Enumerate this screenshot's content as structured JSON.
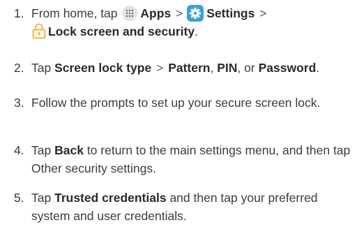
{
  "steps": [
    {
      "number": "1.",
      "parts": {
        "prefix": "From home, tap",
        "apps": "Apps",
        "sep1": ">",
        "settings": "Settings",
        "sep2": ">",
        "lock": "Lock screen and security",
        "suffix": "."
      },
      "icons": [
        "apps-grid-icon",
        "settings-gear-icon",
        "lock-icon"
      ]
    },
    {
      "number": "2.",
      "parts": {
        "prefix": "Tap",
        "screen_lock_type": "Screen lock type",
        "sep": ">",
        "pattern": "Pattern",
        "comma1": ",",
        "pin": "PIN",
        "or": ", or",
        "password": "Password",
        "suffix": "."
      }
    },
    {
      "number": "3.",
      "text": "Follow the prompts to set up your secure screen lock."
    },
    {
      "number": "4.",
      "parts": {
        "prefix": "Tap",
        "back": "Back",
        "rest": "to return to the main settings menu, and then tap Other security settings."
      }
    },
    {
      "number": "5.",
      "parts": {
        "prefix": "Tap",
        "trusted": "Trusted credentials",
        "rest": "and then tap your preferred system and user credentials."
      }
    }
  ],
  "colors": {
    "text": "#3c3c3c",
    "settings_icon_bg": "#3aa0db",
    "lock_icon": "#f5a623",
    "apps_icon_bg": "#e3e3e3"
  }
}
